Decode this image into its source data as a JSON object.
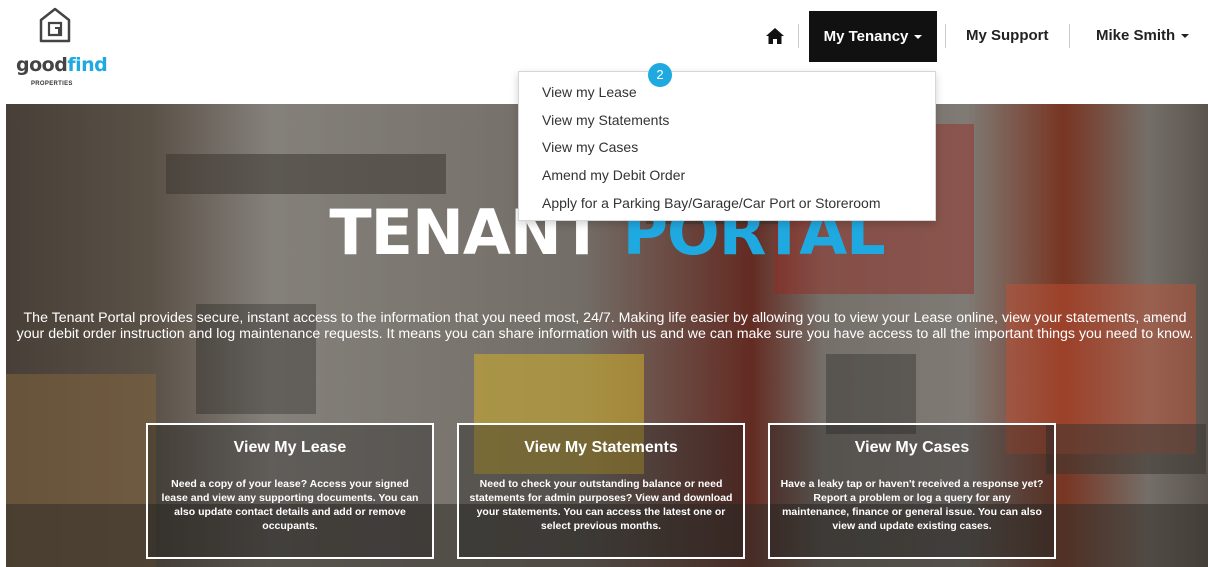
{
  "brand": {
    "name_part1": "good",
    "name_part2": "find",
    "tagline": "PROPERTIES",
    "accent_color": "#1fa9e1",
    "icon": "house-logo-icon"
  },
  "nav": {
    "home_icon": "home-icon",
    "my_tenancy": "My Tenancy",
    "my_support": "My Support",
    "user_name": "Mike Smith"
  },
  "dropdown": {
    "badge": "2",
    "items": [
      "View my Lease",
      "View my Statements",
      "View my Cases",
      "Amend my Debit Order",
      "Apply for a Parking Bay/Garage/Car Port or Storeroom"
    ]
  },
  "hero": {
    "title_white": "TENANT ",
    "title_blue": "PORTAL",
    "description": "The Tenant Portal provides secure, instant access to the information that you need most, 24/7. Making life easier by allowing you to view your Lease online, view your statements, amend your debit order instruction and log maintenance requests. It means you can share information with us and we can make sure you have access to all the important things you need to know."
  },
  "cards": [
    {
      "title": "View My Lease",
      "text": "Need a copy of your lease? Access your signed lease and view any supporting documents. You can also update contact details and add or remove occupants."
    },
    {
      "title": "View My Statements",
      "text": "Need to check your outstanding balance or need statements for admin purposes? View and download your statements. You can access the latest one or select previous months."
    },
    {
      "title": "View My Cases",
      "text": "Have a leaky tap or haven't received a response yet? Report a problem or log a query for any maintenance, finance or general issue. You can also view and update existing cases."
    }
  ]
}
